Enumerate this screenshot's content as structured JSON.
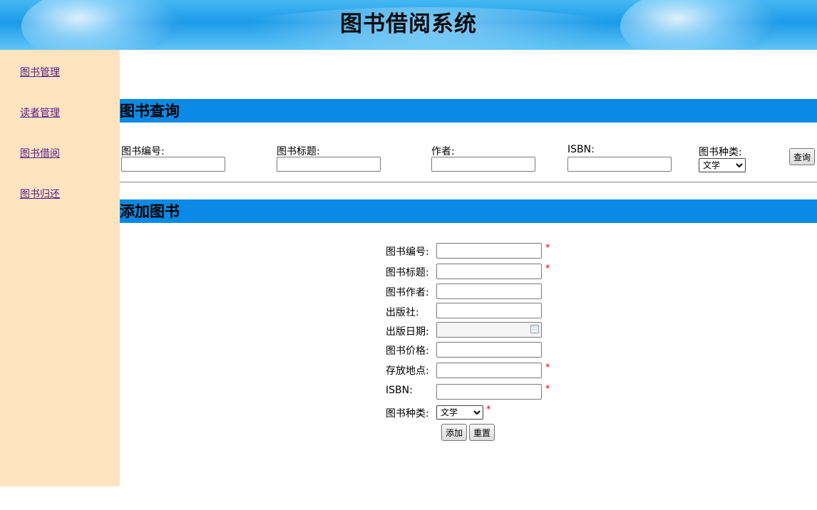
{
  "header": {
    "title": "图书借阅系统"
  },
  "sidebar": {
    "items": [
      {
        "label": "图书管理"
      },
      {
        "label": "读者管理"
      },
      {
        "label": "图书借阅"
      },
      {
        "label": "图书归还"
      }
    ]
  },
  "search": {
    "title": "图书查询",
    "fields": [
      {
        "label": "图书编号:",
        "value": ""
      },
      {
        "label": "图书标题:",
        "value": ""
      },
      {
        "label": "作者:",
        "value": ""
      },
      {
        "label": "ISBN:",
        "value": ""
      }
    ],
    "category": {
      "label": "图书种类:",
      "selected": "文学"
    },
    "query_button": "查询"
  },
  "add": {
    "title": "添加图书",
    "fields": [
      {
        "label": "图书编号:",
        "value": "",
        "required_mark": "*"
      },
      {
        "label": "图书标题:",
        "value": "",
        "required_mark": "*"
      },
      {
        "label": "图书作者:",
        "value": ""
      },
      {
        "label": "出版社:",
        "value": ""
      },
      {
        "label": "出版日期:",
        "value": ""
      },
      {
        "label": "图书价格:",
        "value": ""
      },
      {
        "label": "存放地点:",
        "value": "",
        "required_mark": "*"
      },
      {
        "label": "ISBN:",
        "value": "",
        "required_mark": "*"
      }
    ],
    "category": {
      "label": "图书种类:",
      "selected": "文学",
      "required_mark": "*"
    },
    "add_button": "添加",
    "reset_button": "重置"
  },
  "colors": {
    "section_bar": "#0a8ae6",
    "sidebar_bg": "#ffe4c0",
    "link": "#551a8b",
    "required": "#e00000"
  },
  "icons": {
    "date_picker": "calendar-icon"
  }
}
